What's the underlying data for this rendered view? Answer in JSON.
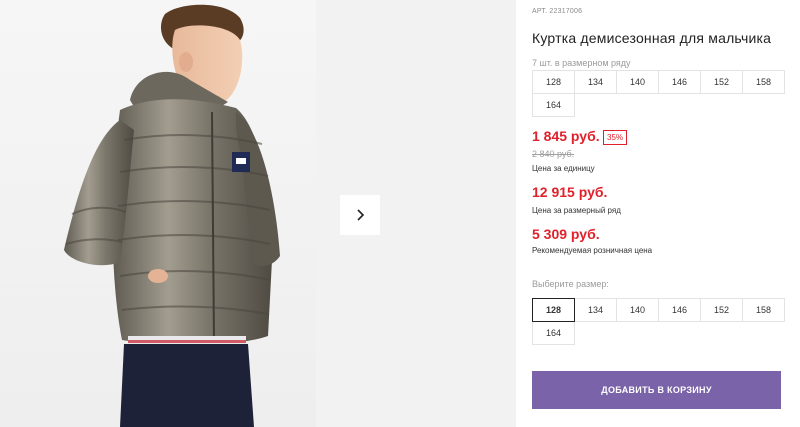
{
  "product": {
    "sku": "АРТ. 22317006",
    "title": "Куртка демисезонная для мальчика",
    "pack_note": "7 шт. в размерном ряду",
    "pack_sizes": [
      "128",
      "134",
      "140",
      "146",
      "152",
      "158",
      "164"
    ]
  },
  "pricing": {
    "unit_price": "1 845 руб.",
    "discount": "35%",
    "old_price": "2 840 руб.",
    "unit_caption": "Цена за единицу",
    "pack_price": "12 915 руб.",
    "pack_caption": "Цена за размерный ряд",
    "rrp_price": "5 309 руб.",
    "rrp_caption": "Рекомендуемая розничная цена"
  },
  "size_selector": {
    "label": "Выберите размер:",
    "sizes": [
      "128",
      "134",
      "140",
      "146",
      "152",
      "158",
      "164"
    ],
    "selected": "128"
  },
  "actions": {
    "add_to_cart": "ДОБАВИТЬ В КОРЗИНУ"
  },
  "gallery": {
    "next_icon": "chevron-right-icon",
    "image": "product-photo"
  },
  "colors": {
    "price": "#e0212b",
    "accent_button": "#7a63a8"
  }
}
